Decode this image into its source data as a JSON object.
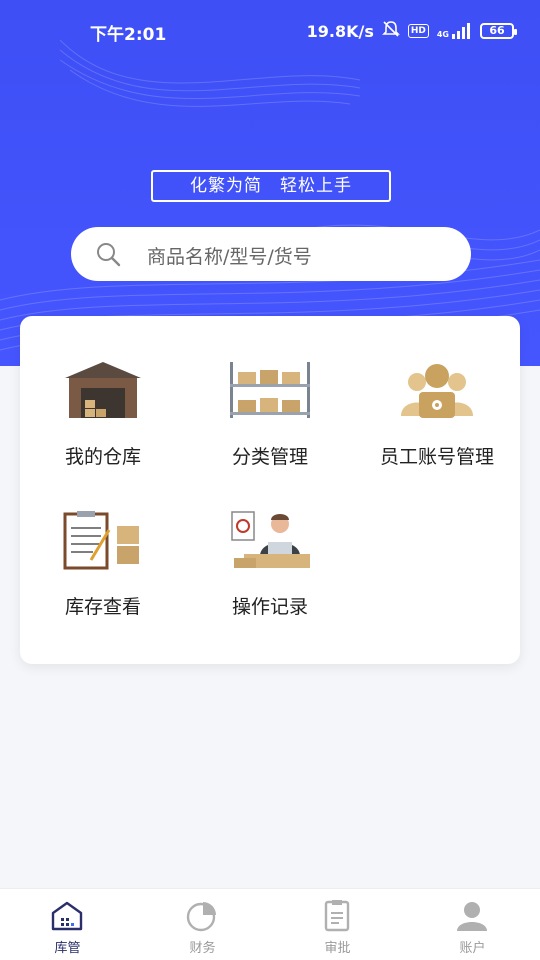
{
  "status_bar": {
    "time": "下午2:01",
    "net_speed": "19.8K/s",
    "hd_badge": "HD",
    "network": "4G",
    "battery": "66"
  },
  "hero": {
    "slogan": "化繁为简　轻松上手"
  },
  "search": {
    "placeholder": "商品名称/型号/货号"
  },
  "menu": {
    "items": [
      {
        "label": "我的仓库",
        "icon": "warehouse-icon"
      },
      {
        "label": "分类管理",
        "icon": "shelf-icon"
      },
      {
        "label": "员工账号管理",
        "icon": "staff-icon"
      },
      {
        "label": "库存查看",
        "icon": "clipboard-icon"
      },
      {
        "label": "操作记录",
        "icon": "worker-icon"
      }
    ]
  },
  "tabbar": {
    "tabs": [
      {
        "label": "库管",
        "icon": "warehouse-tab-icon",
        "active": true
      },
      {
        "label": "财务",
        "icon": "pie-chart-icon",
        "active": false
      },
      {
        "label": "审批",
        "icon": "document-icon",
        "active": false
      },
      {
        "label": "账户",
        "icon": "user-icon",
        "active": false
      }
    ]
  },
  "colors": {
    "brand_blue": "#4353ff",
    "tab_active": "#2a2f6a",
    "tab_inactive": "#9a9a9a",
    "box_tan": "#d7b47b"
  }
}
